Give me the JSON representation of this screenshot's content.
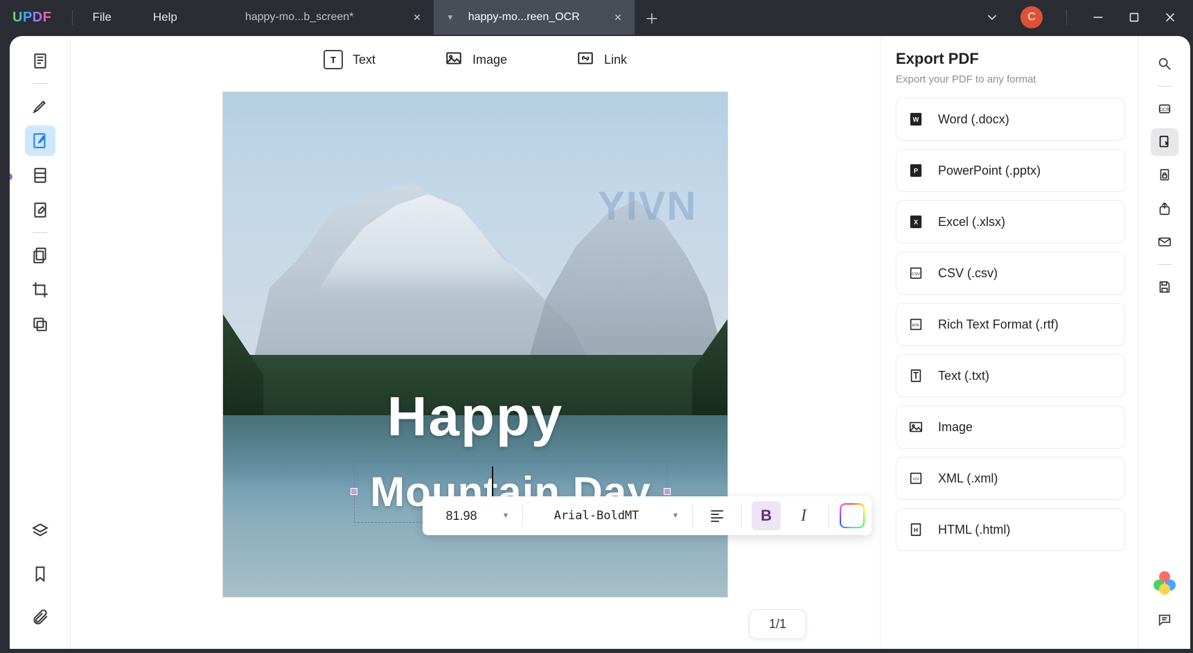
{
  "app": {
    "logo": "UPDF"
  },
  "menu": {
    "file": "File",
    "help": "Help"
  },
  "tabs": [
    {
      "label": "happy-mo...b_screen*",
      "active": false
    },
    {
      "label": "happy-mo...reen_OCR",
      "active": true
    }
  ],
  "user": {
    "initial": "C"
  },
  "modes": {
    "text": "Text",
    "image": "Image",
    "link": "Link"
  },
  "document": {
    "watermark": "YIVN",
    "line1": "Happy",
    "line2": "Mountain Day"
  },
  "format_bar": {
    "font_size": "81.98",
    "font_name": "Arial-BoldMT"
  },
  "export": {
    "title": "Export PDF",
    "subtitle": "Export your PDF to any format",
    "items": [
      {
        "label": "Word (.docx)",
        "icon": "W"
      },
      {
        "label": "PowerPoint (.pptx)",
        "icon": "P"
      },
      {
        "label": "Excel (.xlsx)",
        "icon": "X"
      },
      {
        "label": "CSV (.csv)",
        "icon": "CSV"
      },
      {
        "label": "Rich Text Format (.rtf)",
        "icon": "RTF"
      },
      {
        "label": "Text (.txt)",
        "icon": "T"
      },
      {
        "label": "Image",
        "icon": "IMG"
      },
      {
        "label": "XML (.xml)",
        "icon": "XML"
      },
      {
        "label": "HTML (.html)",
        "icon": "H"
      }
    ]
  },
  "status": {
    "page": "1/1"
  }
}
